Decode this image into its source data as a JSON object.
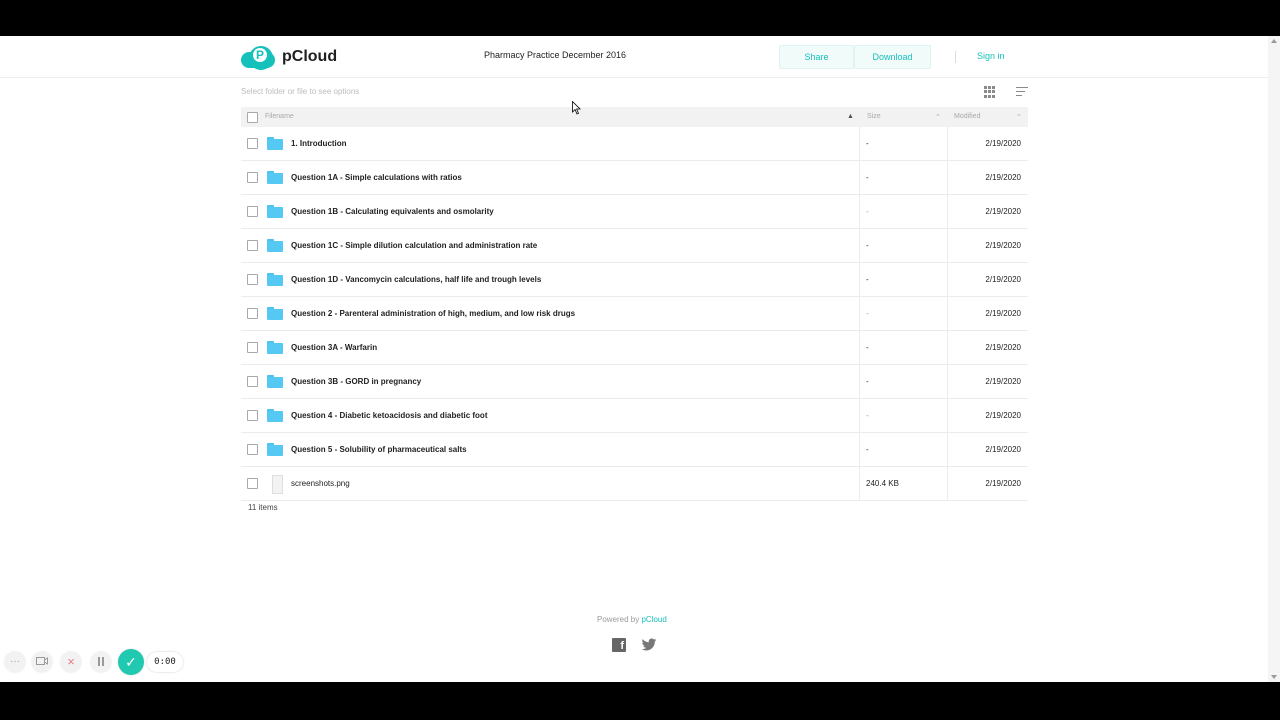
{
  "header": {
    "logo_text": "pCloud",
    "logo_letter": "P",
    "folder_title": "Pharmacy Practice December 2016",
    "share_label": "Share",
    "download_label": "Download",
    "signin_label": "Sign in"
  },
  "toolbar": {
    "hint": "Select folder or file to see options",
    "grid_view_icon": "grid-icon",
    "sort_icon": "sort-icon"
  },
  "table": {
    "columns": {
      "filename": "Filename",
      "size": "Size",
      "modified": "Modified"
    },
    "rows": [
      {
        "name": "1. Introduction",
        "type": "folder",
        "size": "-",
        "modified": "2/19/2020"
      },
      {
        "name": "Question 1A - Simple calculations with ratios",
        "type": "folder",
        "size": "-",
        "modified": "2/19/2020"
      },
      {
        "name": "Question 1B - Calculating equivalents and osmolarity",
        "type": "folder",
        "size": "-",
        "modified": "2/19/2020"
      },
      {
        "name": "Question 1C - Simple dilution calculation and administration rate",
        "type": "folder",
        "size": "-",
        "modified": "2/19/2020"
      },
      {
        "name": "Question 1D - Vancomycin calculations, half life and trough levels",
        "type": "folder",
        "size": "-",
        "modified": "2/19/2020"
      },
      {
        "name": "Question 2 - Parenteral administration of high, medium, and low risk drugs",
        "type": "folder",
        "size": "-",
        "modified": "2/19/2020"
      },
      {
        "name": "Question 3A - Warfarin",
        "type": "folder",
        "size": "-",
        "modified": "2/19/2020"
      },
      {
        "name": "Question 3B - GORD in pregnancy",
        "type": "folder",
        "size": "-",
        "modified": "2/19/2020"
      },
      {
        "name": "Question 4 - Diabetic ketoacidosis and diabetic foot",
        "type": "folder",
        "size": "-",
        "modified": "2/19/2020"
      },
      {
        "name": "Question 5 - Solubility of pharmaceutical salts",
        "type": "folder",
        "size": "-",
        "modified": "2/19/2020"
      },
      {
        "name": "screenshots.png",
        "type": "file",
        "size": "240.4 KB",
        "modified": "2/19/2020"
      }
    ]
  },
  "footer": {
    "item_count": "11 items",
    "powered_prefix": "Powered by ",
    "powered_link": "pCloud"
  },
  "recorder": {
    "more": "···",
    "time": "0:00"
  },
  "colors": {
    "accent": "#17c1bb",
    "folder": "#55c9f3",
    "recorder_check": "#21c9b1"
  }
}
